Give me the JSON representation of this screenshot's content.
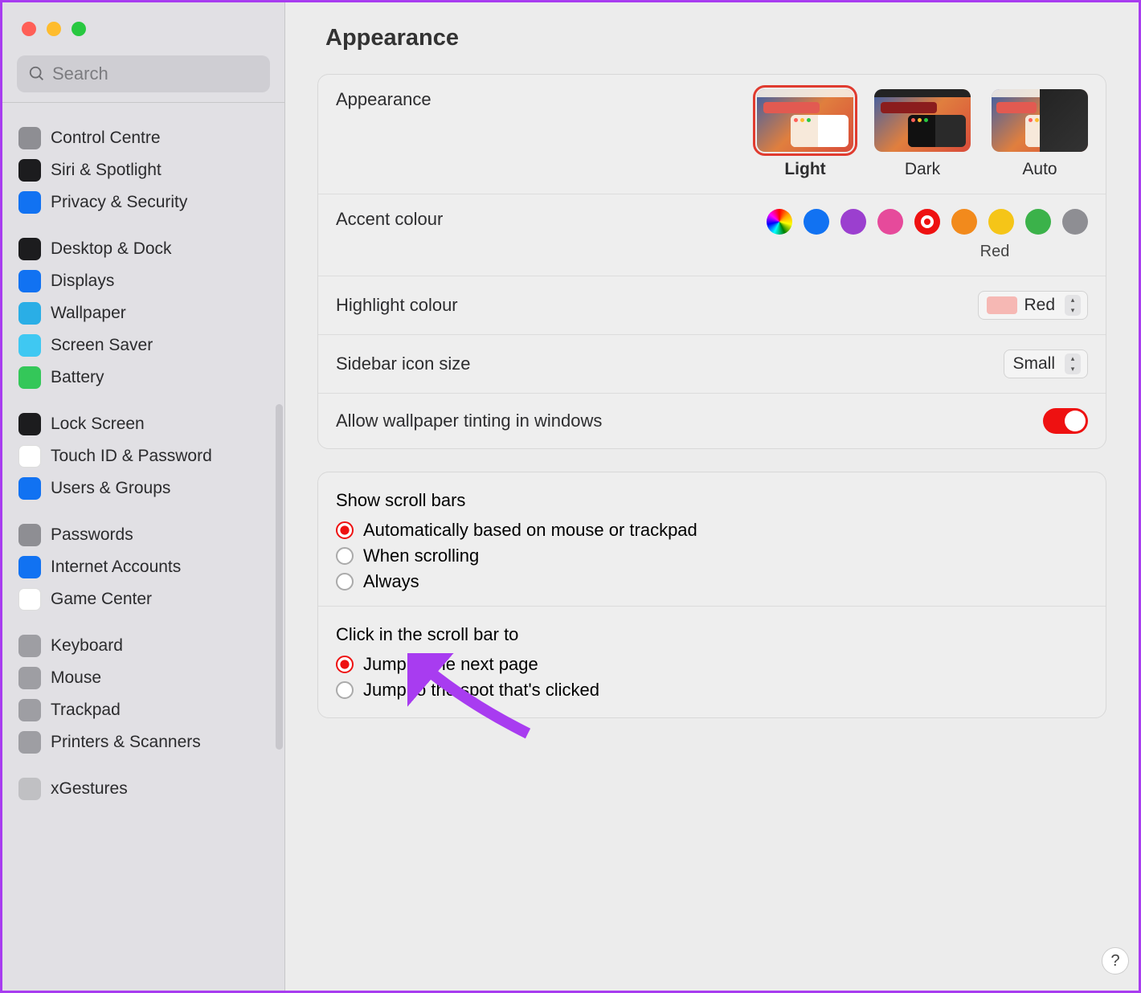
{
  "search": {
    "placeholder": "Search"
  },
  "header": {
    "title": "Appearance"
  },
  "sidebar": {
    "groups": [
      [
        {
          "label": "Control Centre",
          "ic_bg": "#8e8e93"
        },
        {
          "label": "Siri & Spotlight",
          "ic_bg": "#1c1c1e"
        },
        {
          "label": "Privacy & Security",
          "ic_bg": "#1172f2"
        }
      ],
      [
        {
          "label": "Desktop & Dock",
          "ic_bg": "#1c1c1e"
        },
        {
          "label": "Displays",
          "ic_bg": "#1172f2"
        },
        {
          "label": "Wallpaper",
          "ic_bg": "#2aaee6"
        },
        {
          "label": "Screen Saver",
          "ic_bg": "#3fc8f2"
        },
        {
          "label": "Battery",
          "ic_bg": "#34c759"
        }
      ],
      [
        {
          "label": "Lock Screen",
          "ic_bg": "#1c1c1e"
        },
        {
          "label": "Touch ID & Password",
          "ic_bg": "#fff",
          "fg": "#e85d5a",
          "border": "1px solid #ddd"
        },
        {
          "label": "Users & Groups",
          "ic_bg": "#1172f2"
        }
      ],
      [
        {
          "label": "Passwords",
          "ic_bg": "#8e8e93"
        },
        {
          "label": "Internet Accounts",
          "ic_bg": "#1172f2"
        },
        {
          "label": "Game Center",
          "ic_bg": "#fff",
          "border": "1px solid #ddd"
        }
      ],
      [
        {
          "label": "Keyboard",
          "ic_bg": "#9e9ea3"
        },
        {
          "label": "Mouse",
          "ic_bg": "#9e9ea3"
        },
        {
          "label": "Trackpad",
          "ic_bg": "#9e9ea3"
        },
        {
          "label": "Printers & Scanners",
          "ic_bg": "#9e9ea3"
        }
      ],
      [
        {
          "label": "xGestures",
          "ic_bg": "#c0c0c3"
        }
      ]
    ]
  },
  "appearance_section": {
    "label": "Appearance",
    "themes": [
      {
        "name": "Light",
        "selected": true
      },
      {
        "name": "Dark",
        "selected": false
      },
      {
        "name": "Auto",
        "selected": false
      }
    ]
  },
  "accent": {
    "label": "Accent colour",
    "selected_name": "Red",
    "colors": [
      "multi",
      "#1172f2",
      "#9b3fcf",
      "#e64a9b",
      "#e11",
      "#f28a1c",
      "#f5c518",
      "#3bb24a",
      "#8e8e93"
    ]
  },
  "highlight": {
    "label": "Highlight colour",
    "value": "Red"
  },
  "sidebar_icon": {
    "label": "Sidebar icon size",
    "value": "Small"
  },
  "tinting": {
    "label": "Allow wallpaper tinting in windows",
    "on": true
  },
  "scroll_bars": {
    "title": "Show scroll bars",
    "options": [
      {
        "label": "Automatically based on mouse or trackpad",
        "checked": true
      },
      {
        "label": "When scrolling",
        "checked": false
      },
      {
        "label": "Always",
        "checked": false
      }
    ]
  },
  "click_in_scroll": {
    "title": "Click in the scroll bar to",
    "options": [
      {
        "label": "Jump to the next page",
        "checked": true
      },
      {
        "label": "Jump to the spot that's clicked",
        "checked": false
      }
    ]
  },
  "help": "?"
}
